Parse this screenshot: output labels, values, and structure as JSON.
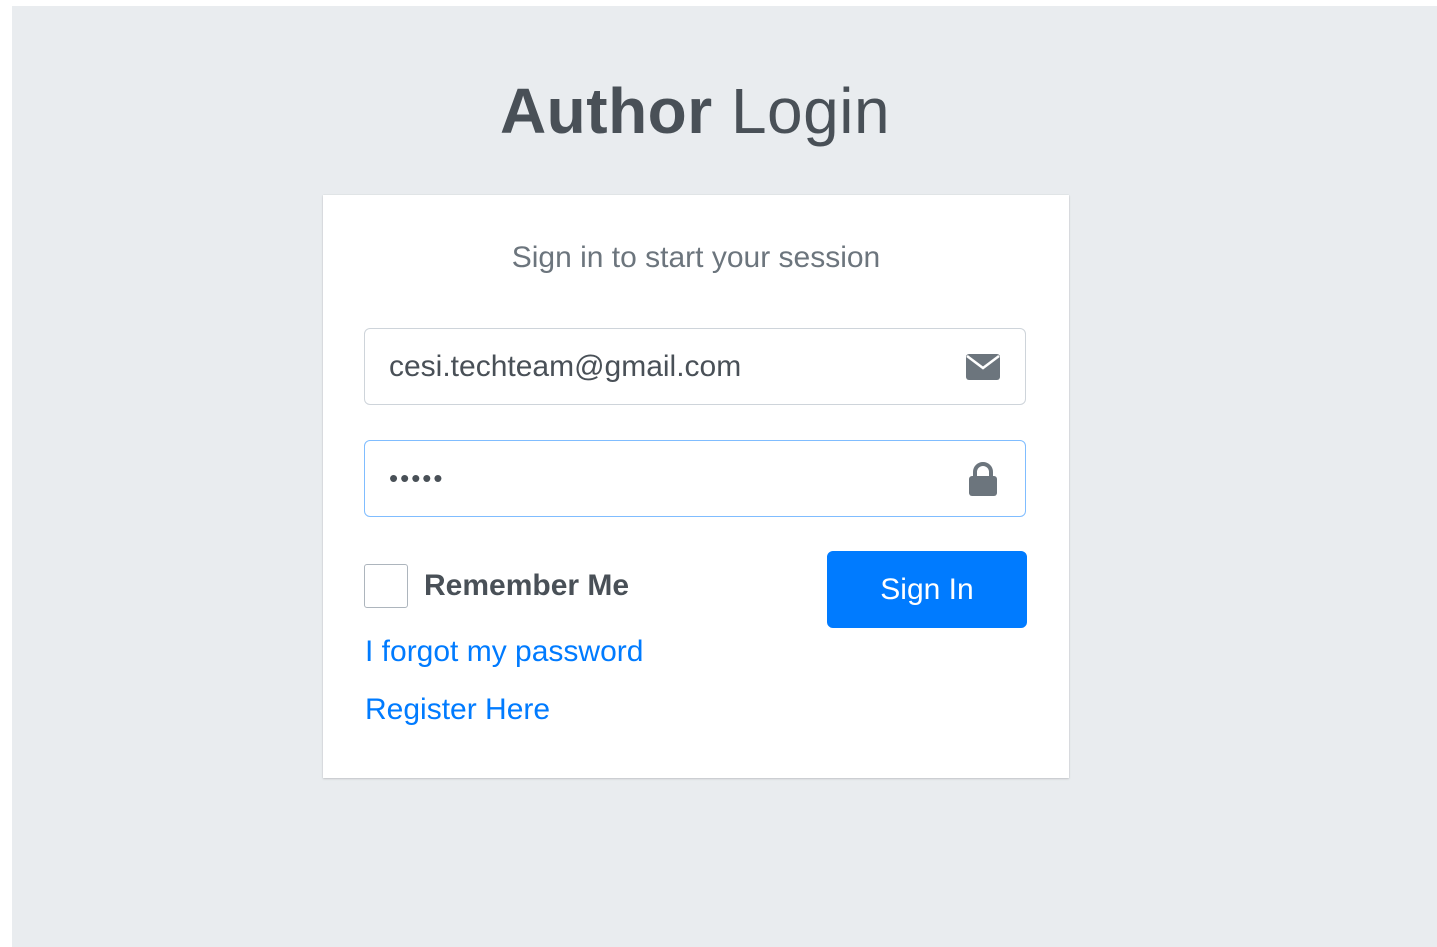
{
  "header": {
    "title_bold": "Author",
    "title_light": "Login"
  },
  "login_box": {
    "message": "Sign in to start your session",
    "email": {
      "value": "cesi.techteam@gmail.com",
      "icon": "envelope-icon"
    },
    "password": {
      "value": "•••••",
      "icon": "lock-icon"
    },
    "remember_label": "Remember Me",
    "remember_checked": false,
    "signin_label": "Sign In",
    "forgot_link": "I forgot my password",
    "register_link": "Register Here"
  },
  "colors": {
    "background": "#e9ecef",
    "primary": "#007bff",
    "text": "#495057",
    "focus_border": "#80bdff"
  }
}
